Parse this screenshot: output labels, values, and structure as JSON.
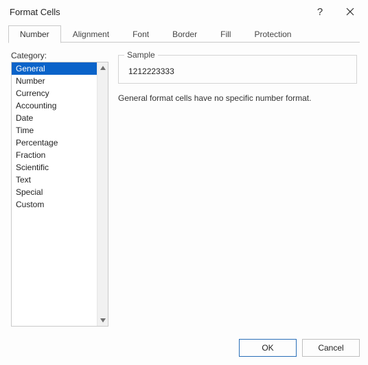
{
  "window": {
    "title": "Format Cells"
  },
  "tabs": {
    "number": "Number",
    "alignment": "Alignment",
    "font": "Font",
    "border": "Border",
    "fill": "Fill",
    "protection": "Protection"
  },
  "category": {
    "label": "Category:",
    "items": [
      "General",
      "Number",
      "Currency",
      "Accounting",
      "Date",
      "Time",
      "Percentage",
      "Fraction",
      "Scientific",
      "Text",
      "Special",
      "Custom"
    ],
    "selected_index": 0
  },
  "sample": {
    "legend": "Sample",
    "value": "1212223333"
  },
  "description": "General format cells have no specific number format.",
  "buttons": {
    "ok": "OK",
    "cancel": "Cancel"
  }
}
